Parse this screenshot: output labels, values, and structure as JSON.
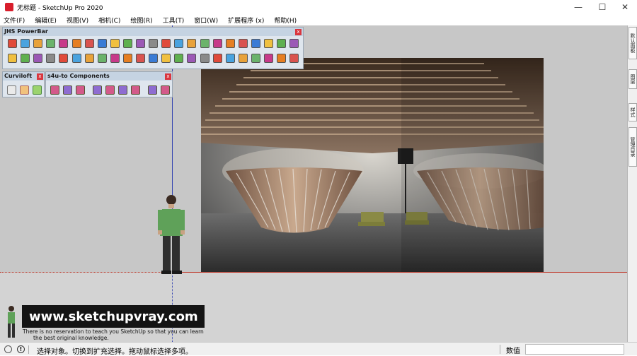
{
  "window": {
    "title": "无标题 - SketchUp Pro 2020",
    "minimize": "—",
    "maximize": "☐",
    "close": "✕"
  },
  "menu": [
    {
      "label": "文件(F)"
    },
    {
      "label": "编辑(E)"
    },
    {
      "label": "视图(V)"
    },
    {
      "label": "相机(C)"
    },
    {
      "label": "绘图(R)"
    },
    {
      "label": "工具(T)"
    },
    {
      "label": "窗口(W)"
    },
    {
      "label": "扩展程序 (x)"
    },
    {
      "label": "帮助(H)"
    }
  ],
  "toolbars": {
    "jhs": {
      "title": "JHS PowerBar",
      "close": "x"
    },
    "curviloft": {
      "title": "Curviloft",
      "close": "x"
    },
    "s4u": {
      "title": "s4u-to Components",
      "close": "x"
    }
  },
  "right_panel": {
    "tabs": [
      "默认面板",
      "图层",
      "样式",
      "管理目录"
    ]
  },
  "watermark": {
    "url": "www.sketchupvray.com",
    "line1": "There is no reservation to teach you SketchUp so that you can learn",
    "line2": "the best original knowledge."
  },
  "status": {
    "text": "选择对象。切换到扩充选择。拖动鼠标选择多项。",
    "measure_label": "数值",
    "measure_value": ""
  },
  "colors": {
    "canvas": "#c7c7c7",
    "red_axis": "#c0392b",
    "blue_axis": "#3040b0",
    "toolbar_bg": "#dfe6ee"
  }
}
